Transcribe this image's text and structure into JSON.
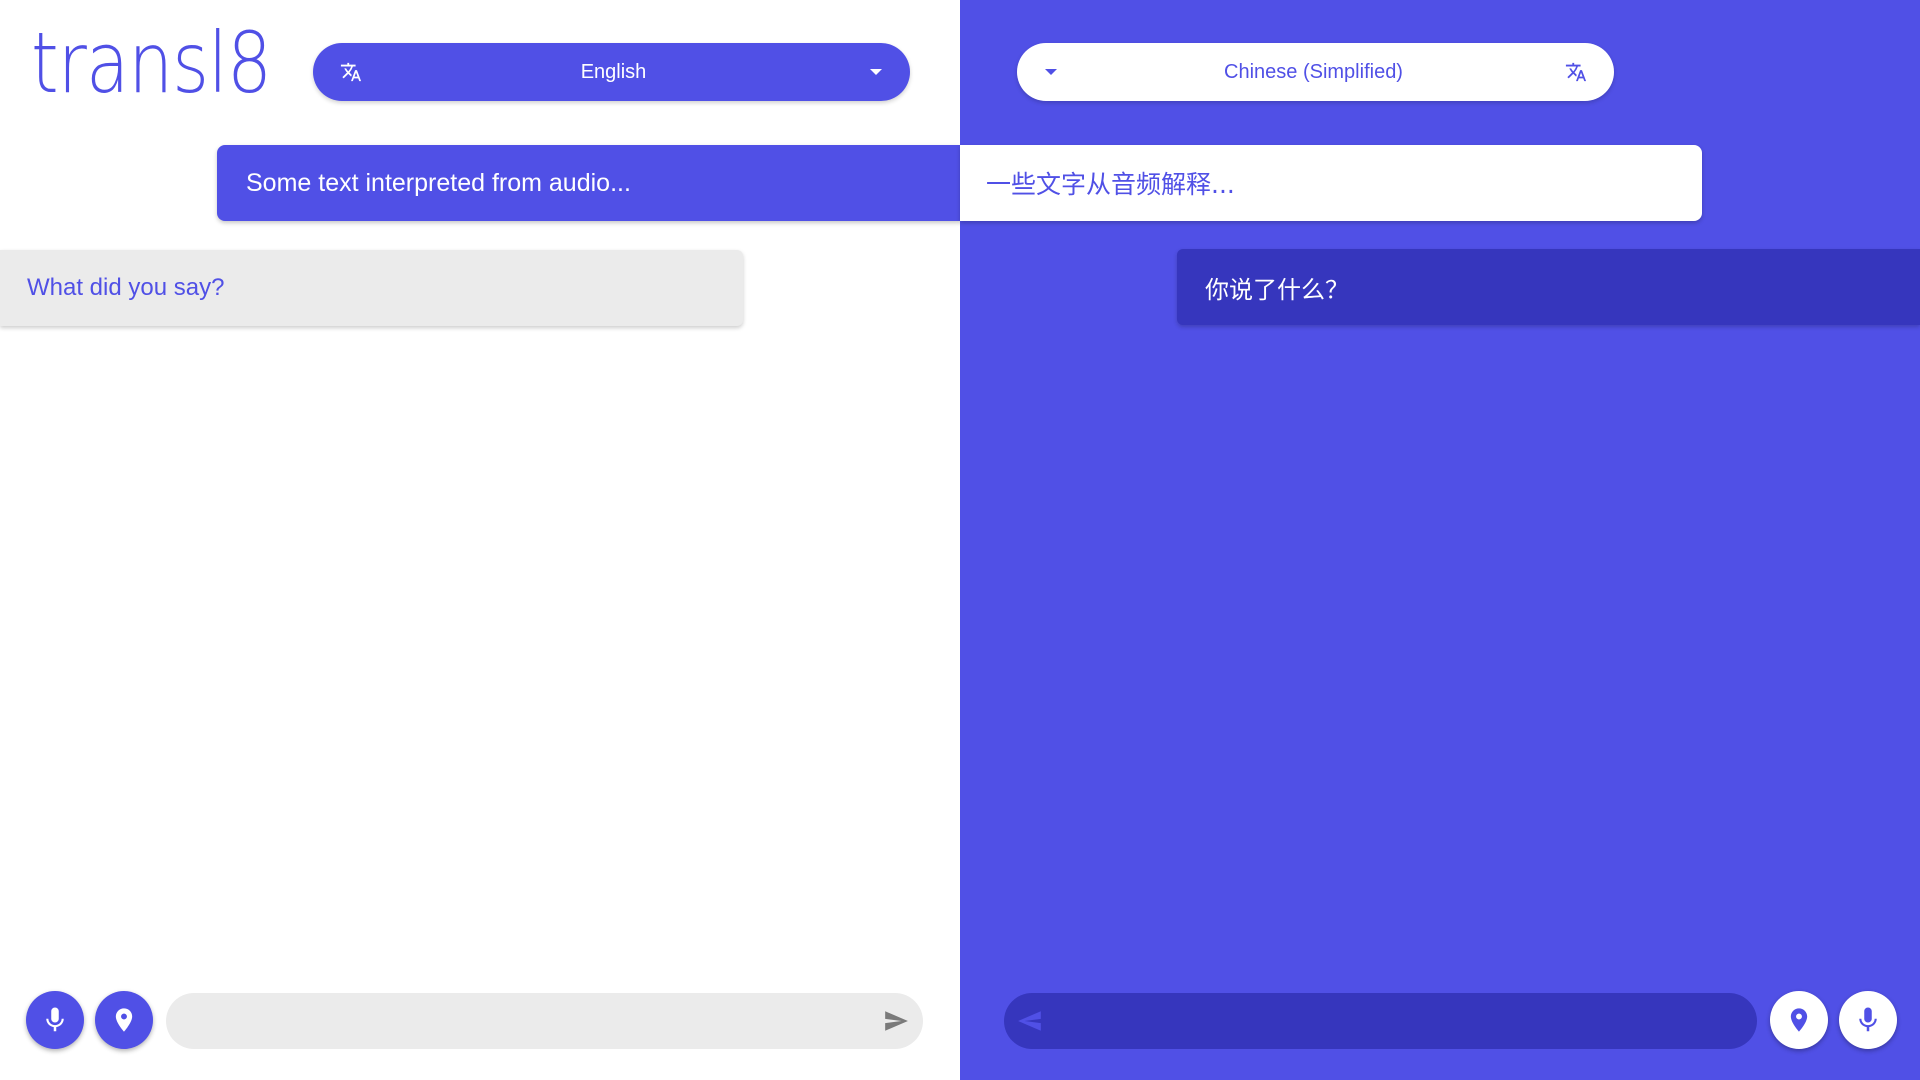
{
  "app": {
    "logo_text": "transl8"
  },
  "left": {
    "language": {
      "selected": "English",
      "icon": "translate-icon",
      "dropdown_icon": "caret-down-icon"
    },
    "interpreted_text": "Some text interpreted from audio...",
    "messages": [
      {
        "text": "What did you say?"
      }
    ],
    "composer": {
      "value": "",
      "placeholder": "",
      "mic_icon": "microphone-icon",
      "location_icon": "location-pin-icon",
      "send_icon": "send-icon"
    }
  },
  "right": {
    "language": {
      "selected": "Chinese (Simplified)",
      "icon": "translate-icon",
      "dropdown_icon": "caret-down-icon"
    },
    "interpreted_text": "一些文字从音频解释...",
    "messages": [
      {
        "text": "你说了什么？"
      }
    ],
    "composer": {
      "value": "",
      "placeholder": "",
      "mic_icon": "microphone-icon",
      "location_icon": "location-pin-icon",
      "send_icon": "send-icon"
    }
  },
  "colors": {
    "accent": "#5050e6",
    "accent_dark": "#3636bd",
    "bubble_light": "#ebebeb",
    "send_grey": "#7a7a7a"
  }
}
